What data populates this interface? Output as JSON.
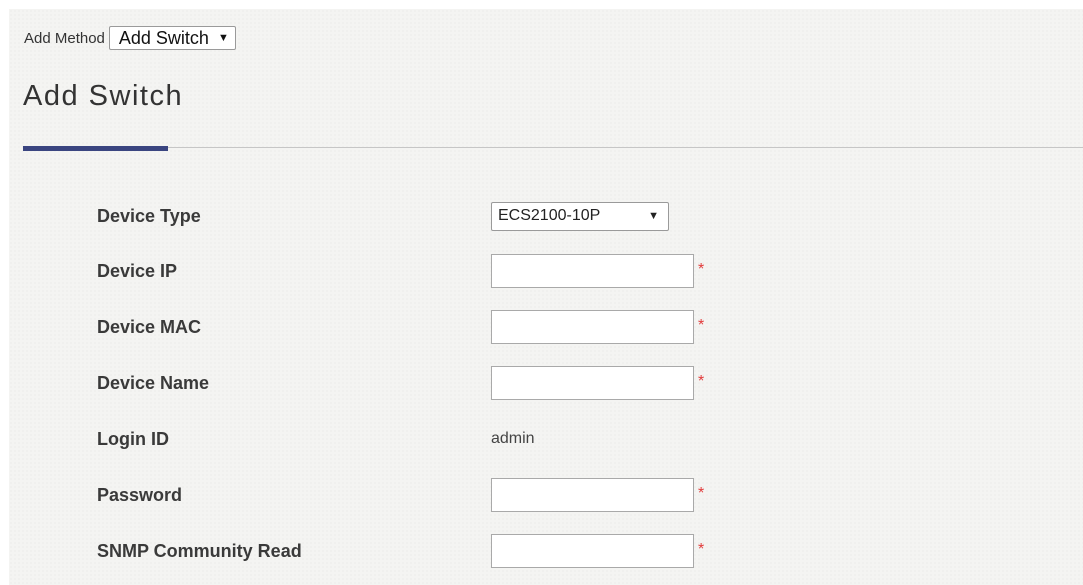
{
  "add_method": {
    "label": "Add Method",
    "selected": "Add Switch"
  },
  "page": {
    "title": "Add Switch"
  },
  "form": {
    "device_type": {
      "label": "Device Type",
      "selected": "ECS2100-10P"
    },
    "device_ip": {
      "label": "Device IP",
      "value": "",
      "required_mark": "*"
    },
    "device_mac": {
      "label": "Device MAC",
      "value": "",
      "required_mark": "*"
    },
    "device_name": {
      "label": "Device Name",
      "value": "",
      "required_mark": "*"
    },
    "login_id": {
      "label": "Login ID",
      "value": "admin"
    },
    "password": {
      "label": "Password",
      "value": "",
      "required_mark": "*"
    },
    "snmp_community_read": {
      "label": "SNMP Community Read",
      "value": "",
      "required_mark": "*"
    }
  },
  "icons": {
    "dropdown_arrow": "▼"
  },
  "colors": {
    "accent": "#3a4580",
    "required": "#e23b3b",
    "background": "#f4f4f2"
  }
}
